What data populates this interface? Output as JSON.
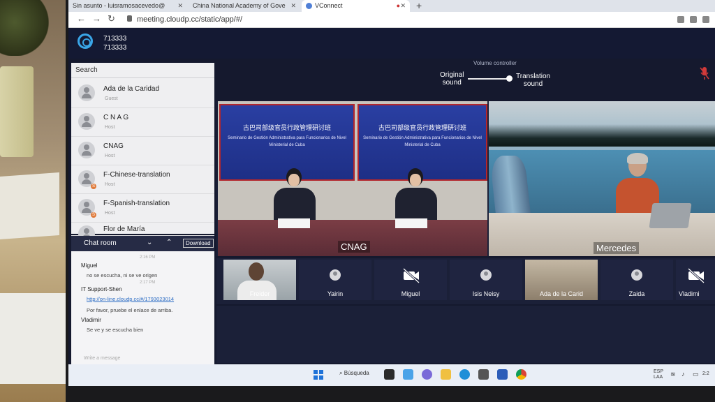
{
  "browser": {
    "tabs": [
      {
        "label": "Sin asunto - luisramosacevedo@",
        "active": false
      },
      {
        "label": "China National Academy of Gove",
        "active": false
      },
      {
        "label": "VConnect",
        "active": true
      }
    ],
    "url": "meeting.cloudp.cc/static/app/#/"
  },
  "meeting": {
    "id_line1": "713333",
    "id_line2": "713333"
  },
  "volume": {
    "title": "Volume controller",
    "left_label": "Original\nsound",
    "right_label": "Translation\nsound"
  },
  "sidebar": {
    "search_placeholder": "Search",
    "participants": [
      {
        "name": "Ada de la Caridad",
        "role": "Guest",
        "badge": ""
      },
      {
        "name": "C N A G",
        "role": "Host",
        "badge": ""
      },
      {
        "name": "CNAG",
        "role": "Host",
        "badge": ""
      },
      {
        "name": "F-Chinese-translation",
        "role": "Host",
        "badge": "S"
      },
      {
        "name": "F-Spanish-translation",
        "role": "Host",
        "badge": "S"
      },
      {
        "name": "Flor de María",
        "role": "",
        "badge": ""
      }
    ]
  },
  "chat": {
    "title": "Chat room",
    "download": "Download",
    "messages": [
      {
        "time": "2:16 PM",
        "name": "Miguel",
        "text": "no se escucha, ni se ve origen",
        "link": false
      },
      {
        "time": "2:17 PM",
        "name": "IT Support-Shen",
        "text": "http://on-line.cloudp.cc/#/1793023014",
        "link": true
      },
      {
        "time": "",
        "name": "",
        "text": "Por favor, pruebe el enlace de arriba.",
        "link": false
      },
      {
        "time": "",
        "name": "Vladimir",
        "text": "Se ve y se escucha bien",
        "link": false
      }
    ],
    "input_placeholder": "Write a message"
  },
  "stage": {
    "banner_cn": "古巴司部级官员行政管理研讨班",
    "banner_es": "Seminario de Gestión Administrativa para Funcionarios de Nivel Ministerial de Cuba",
    "main_label": "CNAG",
    "second_label": "Mercedes"
  },
  "thumbnails": [
    {
      "name": "Freider",
      "kind": "photo"
    },
    {
      "name": "Yairin",
      "kind": "avatar"
    },
    {
      "name": "Miguel",
      "kind": "camoff"
    },
    {
      "name": "Isis Neisy",
      "kind": "avatar"
    },
    {
      "name": "Ada de la Carid",
      "kind": "photo"
    },
    {
      "name": "Zaida",
      "kind": "avatar"
    },
    {
      "name": "Vladimi",
      "kind": "camoff"
    }
  ],
  "taskbar": {
    "search": "Búsqueda",
    "lang": "ESP\nLAA",
    "clock": "2:2"
  },
  "colors": {
    "accent": "#3aa6e8",
    "app_bg": "#141933",
    "stage_bg": "#1b2038"
  }
}
